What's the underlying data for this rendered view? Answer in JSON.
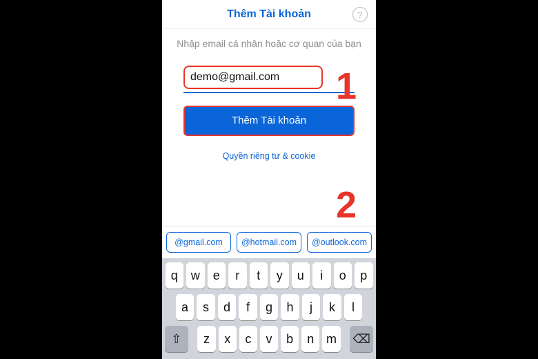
{
  "header": {
    "title": "Thêm Tài khoản",
    "help_glyph": "?"
  },
  "content": {
    "instruction": "Nhập email cá nhân hoặc cơ quan của bạn",
    "email_value": "demo@gmail.com",
    "primary_button": "Thêm Tài khoản",
    "privacy_link": "Quyền riêng tư & cookie"
  },
  "callouts": {
    "one": "1",
    "two": "2"
  },
  "suggestions": [
    "@gmail.com",
    "@hotmail.com",
    "@outlook.com"
  ],
  "keyboard": {
    "row1": [
      "q",
      "w",
      "e",
      "r",
      "t",
      "y",
      "u",
      "i",
      "o",
      "p"
    ],
    "row2": [
      "a",
      "s",
      "d",
      "f",
      "g",
      "h",
      "j",
      "k",
      "l"
    ],
    "row3": [
      "z",
      "x",
      "c",
      "v",
      "b",
      "n",
      "m"
    ],
    "shift_glyph": "⇧",
    "backspace_glyph": "⌫"
  },
  "colors": {
    "accent": "#0a65d8",
    "annotation": "#e8342a"
  }
}
